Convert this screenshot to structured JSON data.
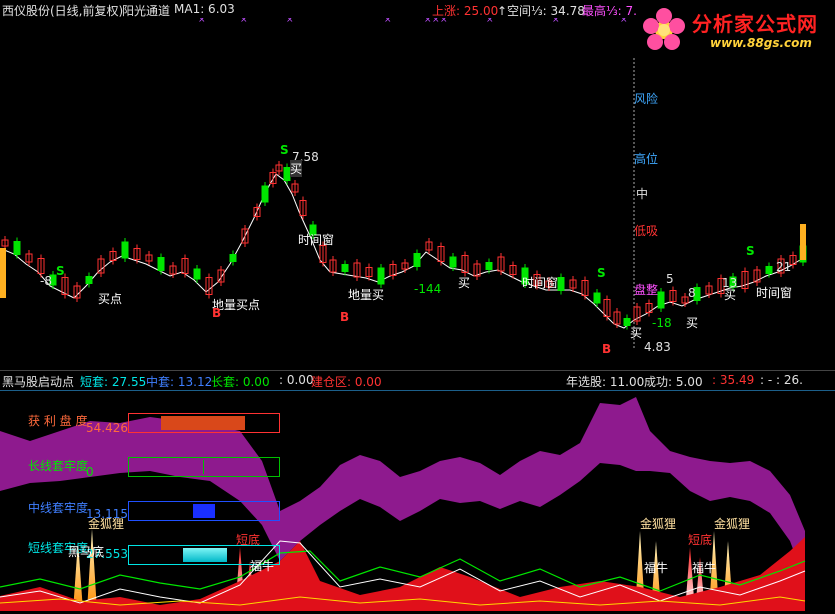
{
  "header": {
    "title": "西仪股份(日线,前复权)",
    "indicator": "阳光通道",
    "ma_label": "MA1: 6.03",
    "up_label": "上涨: 25.00",
    "space_label": "↑空间⅓: 34.78",
    "high_label": "最高⅓: 7."
  },
  "logo": {
    "name": "分析家公式网",
    "url": "www.88gs.com"
  },
  "main_labels": {
    "risk": "风险",
    "high": "高位",
    "mid": "中",
    "low_buy": "低吸",
    "consolidate": "盘整",
    "price_high": "7.58",
    "price_low": "4.83",
    "buy": "买",
    "buy_point": "买点",
    "ground_buy_point": "地量买点",
    "ground_buy": "地量买",
    "time_window": "时间窗",
    "s": "S",
    "b": "B",
    "n1": "-8",
    "n2": "-144",
    "n3": "-18",
    "n4": "5",
    "n5": "8",
    "n6": "13",
    "n7": "21"
  },
  "ind_header": {
    "name": "黑马股启动点",
    "short": "短套: 27.55",
    "mid": "中套: 13.12",
    "long": "长套: 0.00",
    "zero": ": 0.00",
    "build": "建仓区: 0.00",
    "year_pick": "年选股: 11.00",
    "success": "成功: 5.00",
    "v1": ": 35.49",
    "v2": ": - : 26."
  },
  "ind_bars": {
    "profit_label": "获 利 盘 度",
    "profit_value": "54.426",
    "profit_fill": 0.77,
    "long_label": "长线套牢度",
    "long_value": "0",
    "mid_label": "中线套牢度",
    "mid_value": "13.115",
    "short_label": "短线套牢度",
    "short_value": "27.553"
  },
  "ind_labels": {
    "fox": "金狐狸",
    "short_bottom": "短底",
    "fortune": "福牛",
    "dark_horse_bottom": "黑马底"
  },
  "colors": {
    "up": "#ff3232",
    "down": "#00e600",
    "band": "#8e1a8e",
    "text_blue": "#3fa9ff",
    "cyan": "#00e5e5"
  }
}
